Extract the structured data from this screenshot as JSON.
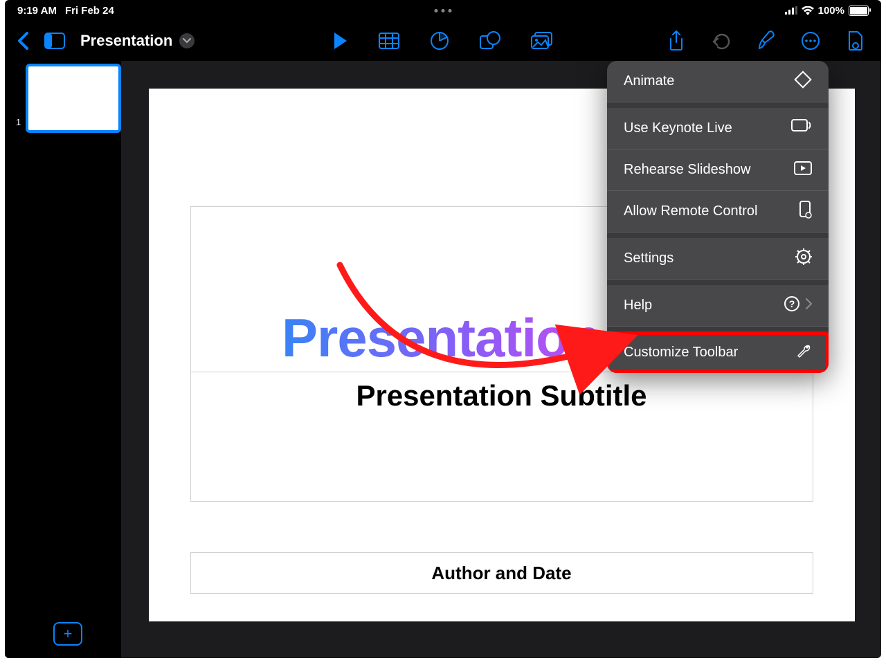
{
  "statusbar": {
    "time": "9:19 AM",
    "date": "Fri Feb 24",
    "battery_pct": "100%"
  },
  "toolbar": {
    "doc_title": "Presentation"
  },
  "sidebar": {
    "slide_number": "1",
    "add_label": "+"
  },
  "slide": {
    "title": "Presentation Title",
    "subtitle": "Presentation Subtitle",
    "author": "Author and Date"
  },
  "menu": {
    "items": [
      {
        "label": "Animate",
        "icon": "diamond"
      },
      {
        "label": "Use Keynote Live",
        "icon": "cast"
      },
      {
        "label": "Rehearse Slideshow",
        "icon": "play-rect"
      },
      {
        "label": "Allow Remote Control",
        "icon": "phone-dot"
      },
      {
        "label": "Settings",
        "icon": "gear"
      },
      {
        "label": "Help",
        "icon": "question",
        "chevron": true
      },
      {
        "label": "Customize Toolbar",
        "icon": "wrench",
        "highlight": true
      }
    ]
  }
}
